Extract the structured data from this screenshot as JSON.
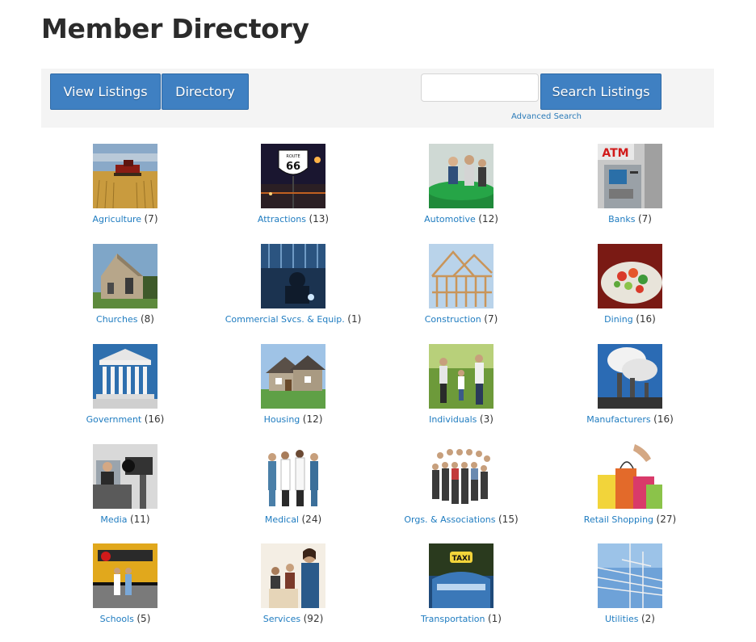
{
  "page": {
    "title": "Member Directory"
  },
  "toolbar": {
    "view_listings_label": "View Listings",
    "directory_label": "Directory",
    "search_value": "",
    "search_button_label": "Search Listings",
    "advanced_search_label": "Advanced Search"
  },
  "categories": [
    {
      "label": "Agriculture",
      "count": "(7)",
      "icon": "wheat-field-icon"
    },
    {
      "label": "Attractions",
      "count": "(13)",
      "icon": "route-66-sign-icon"
    },
    {
      "label": "Automotive",
      "count": "(12)",
      "icon": "car-dealership-icon"
    },
    {
      "label": "Banks",
      "count": "(7)",
      "icon": "atm-icon"
    },
    {
      "label": "Churches",
      "count": "(8)",
      "icon": "church-icon"
    },
    {
      "label": "Commercial Svcs. & Equip.",
      "count": "(1)",
      "icon": "welder-icon"
    },
    {
      "label": "Construction",
      "count": "(7)",
      "icon": "house-frame-icon"
    },
    {
      "label": "Dining",
      "count": "(16)",
      "icon": "salad-bowl-icon"
    },
    {
      "label": "Government",
      "count": "(16)",
      "icon": "capitol-building-icon"
    },
    {
      "label": "Housing",
      "count": "(12)",
      "icon": "house-icon"
    },
    {
      "label": "Individuals",
      "count": "(3)",
      "icon": "family-icon"
    },
    {
      "label": "Manufacturers",
      "count": "(16)",
      "icon": "factory-smokestack-icon"
    },
    {
      "label": "Media",
      "count": "(11)",
      "icon": "news-camera-icon"
    },
    {
      "label": "Medical",
      "count": "(24)",
      "icon": "medical-staff-icon"
    },
    {
      "label": "Orgs. & Associations",
      "count": "(15)",
      "icon": "group-of-people-icon"
    },
    {
      "label": "Retail Shopping",
      "count": "(27)",
      "icon": "shopping-bags-icon"
    },
    {
      "label": "Schools",
      "count": "(5)",
      "icon": "school-bus-icon"
    },
    {
      "label": "Services",
      "count": "(92)",
      "icon": "office-worker-icon"
    },
    {
      "label": "Transportation",
      "count": "(1)",
      "icon": "taxi-icon"
    },
    {
      "label": "Utilities",
      "count": "(2)",
      "icon": "power-lines-icon"
    }
  ]
}
